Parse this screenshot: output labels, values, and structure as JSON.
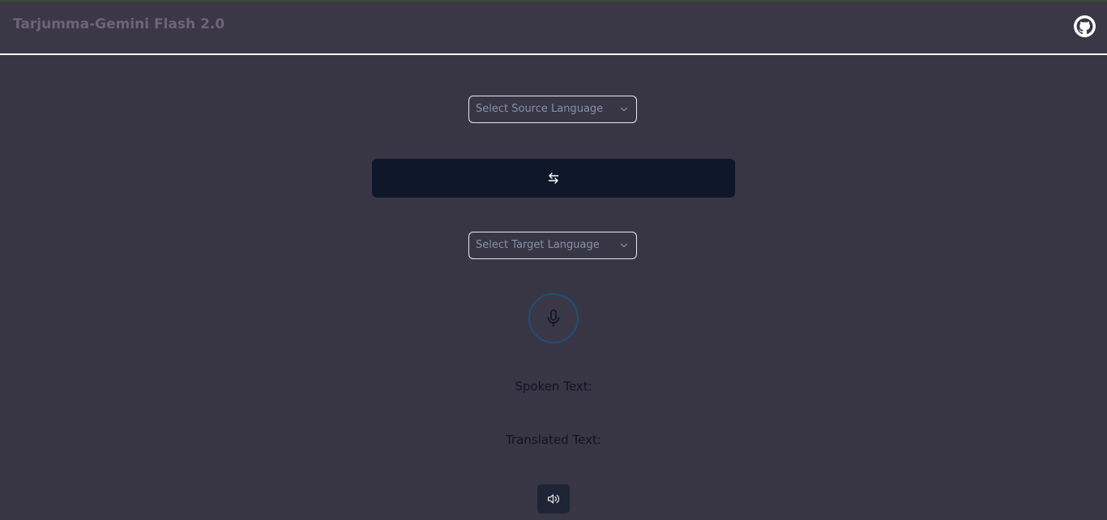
{
  "header": {
    "title": "Tarjumma-Gemini Flash 2.0",
    "github_icon": "github-icon"
  },
  "source_select": {
    "placeholder": "Select Source Language",
    "icon": "chevron-down-icon"
  },
  "swap_button": {
    "icon": "swap-arrows-icon"
  },
  "target_select": {
    "placeholder": "Select Target Language",
    "icon": "chevron-down-icon"
  },
  "mic_button": {
    "icon": "microphone-icon"
  },
  "spoken": {
    "label": "Spoken Text:"
  },
  "translated": {
    "label": "Translated Text:"
  },
  "speak_button": {
    "icon": "speaker-icon"
  },
  "colors": {
    "background": "#383645",
    "swap_button": "#0f172a",
    "mic_ring": "#1f4f78",
    "title": "#6e6378"
  }
}
